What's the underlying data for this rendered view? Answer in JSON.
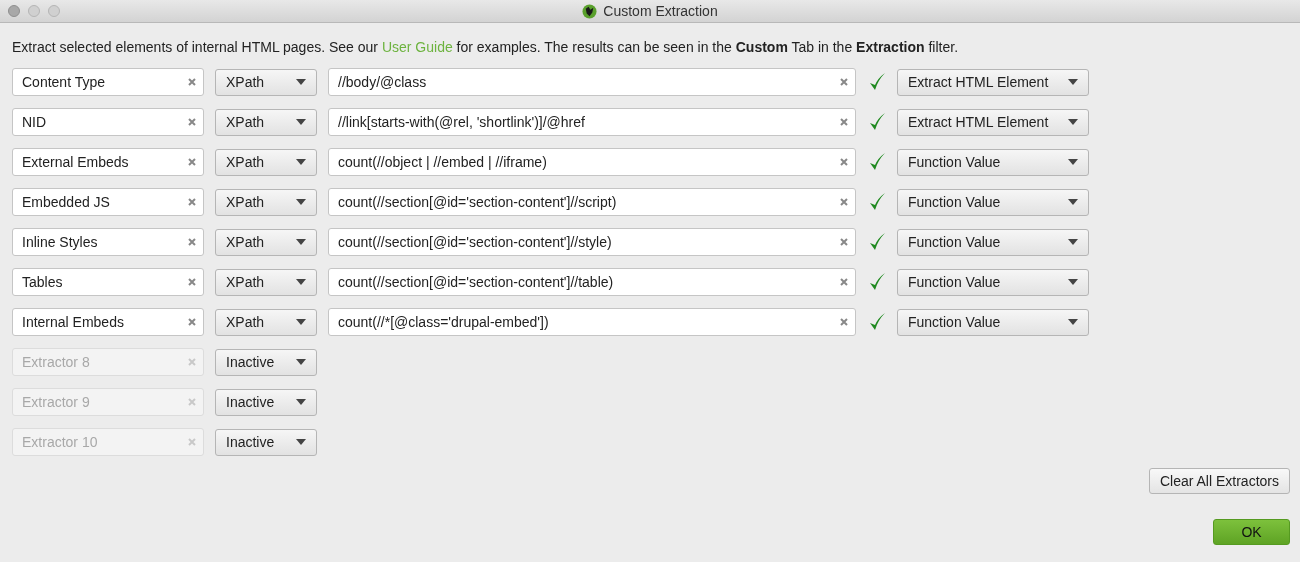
{
  "window": {
    "title": "Custom Extraction"
  },
  "intro": {
    "before": "Extract selected elements of internal HTML pages. See our",
    "link": "User Guide",
    "after": "for examples. The results can be seen in the **Custom** Tab in the **Extraction** filter."
  },
  "extractors": [
    {
      "name": "Content Type",
      "active": true,
      "mode": "XPath",
      "expression": "//body/@class",
      "valid": true,
      "output": "Extract HTML Element"
    },
    {
      "name": "NID",
      "active": true,
      "mode": "XPath",
      "expression": "//link[starts-with(@rel, 'shortlink')]/@href",
      "valid": true,
      "output": "Extract HTML Element"
    },
    {
      "name": "External Embeds",
      "active": true,
      "mode": "XPath",
      "expression": "count(//object | //embed | //iframe)",
      "valid": true,
      "output": "Function Value"
    },
    {
      "name": "Embedded JS",
      "active": true,
      "mode": "XPath",
      "expression": "count(//section[@id='section-content']//script)",
      "valid": true,
      "output": "Function Value"
    },
    {
      "name": "Inline Styles",
      "active": true,
      "mode": "XPath",
      "expression": "count(//section[@id='section-content']//style)",
      "valid": true,
      "output": "Function Value"
    },
    {
      "name": "Tables",
      "active": true,
      "mode": "XPath",
      "expression": "count(//section[@id='section-content']//table)",
      "valid": true,
      "output": "Function Value"
    },
    {
      "name": "Internal Embeds",
      "active": true,
      "mode": "XPath",
      "expression": "count(//*[@class='drupal-embed'])",
      "valid": true,
      "output": "Function Value"
    },
    {
      "name": "Extractor 8",
      "active": false,
      "mode": "Inactive"
    },
    {
      "name": "Extractor 9",
      "active": false,
      "mode": "Inactive"
    },
    {
      "name": "Extractor 10",
      "active": false,
      "mode": "Inactive"
    }
  ],
  "buttons": {
    "clear": "Clear All Extractors",
    "ok": "OK"
  }
}
